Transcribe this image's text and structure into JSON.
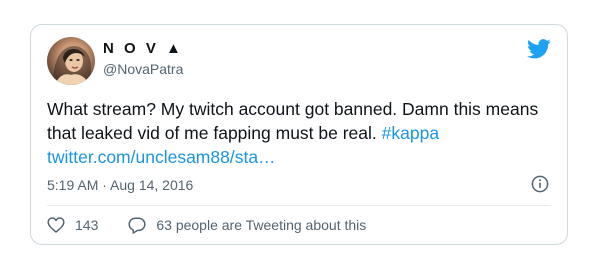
{
  "tweet": {
    "display_name": "N O V ▲",
    "handle": "@NovaPatra",
    "text": "What stream? My twitch account got banned. Damn this means that leaked vid of me fapping must be real. ",
    "hashtag": "#kappa",
    "link": "twitter.com/unclesam88/sta…",
    "timestamp": "5:19 AM · Aug 14, 2016",
    "like_count": "143",
    "reply_label": "63 people are Tweeting about this"
  },
  "icons": {
    "brand": "twitter-bird-icon",
    "info": "info-icon",
    "like": "heart-icon",
    "reply": "speech-bubble-icon"
  },
  "colors": {
    "brand": "#1DA1F2",
    "link": "#1B95E0",
    "text": "#0F1419",
    "secondary": "#536471",
    "border": "#CFD9DE"
  }
}
